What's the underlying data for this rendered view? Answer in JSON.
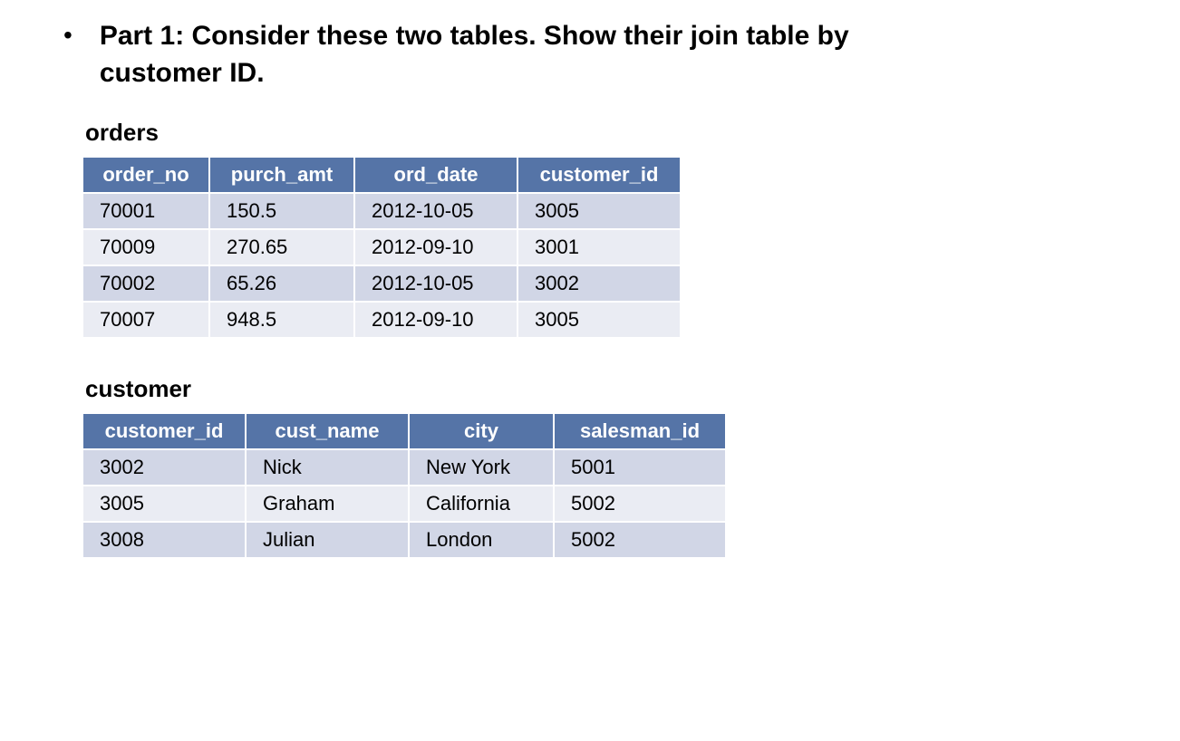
{
  "question": "Part 1: Consider these two tables. Show their join table by customer ID.",
  "tables": {
    "orders": {
      "title": "orders",
      "headers": [
        "order_no",
        "purch_amt",
        "ord_date",
        "customer_id"
      ],
      "rows": [
        [
          "70001",
          "150.5",
          "2012-10-05",
          "3005"
        ],
        [
          "70009",
          "270.65",
          "2012-09-10",
          "3001"
        ],
        [
          "70002",
          "65.26",
          "2012-10-05",
          "3002"
        ],
        [
          "70007",
          "948.5",
          "2012-09-10",
          "3005"
        ]
      ]
    },
    "customer": {
      "title": "customer",
      "headers": [
        "customer_id",
        "cust_name",
        "city",
        "salesman_id"
      ],
      "rows": [
        [
          "3002",
          "Nick",
          "New York",
          "5001"
        ],
        [
          "3005",
          "Graham",
          "California",
          "5002"
        ],
        [
          "3008",
          "Julian",
          "London",
          "5002"
        ]
      ]
    }
  }
}
